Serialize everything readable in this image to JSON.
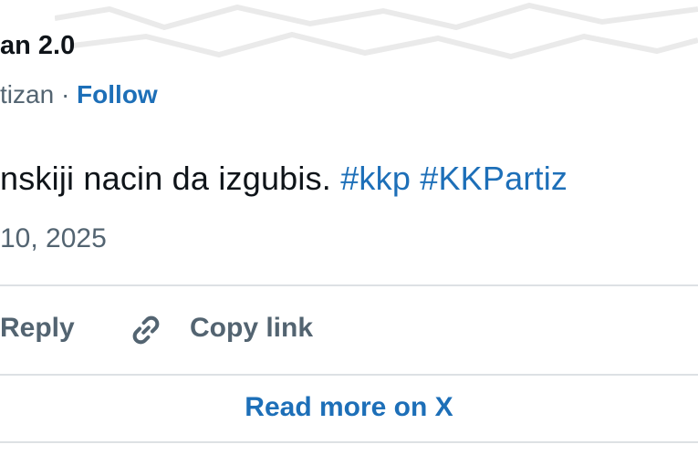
{
  "author": {
    "display_name": "an 2.0",
    "handle": "tizan",
    "separator": "·",
    "follow_label": "Follow"
  },
  "tweet": {
    "text_prefix": "nskiji nacin da izgubis.",
    "hashtags": [
      "#kkp",
      "#KKPartiz"
    ],
    "date": "10, 2025"
  },
  "actions": {
    "reply_label": "Reply",
    "copy_link_label": "Copy link"
  },
  "footer": {
    "read_more_label": "Read more on X"
  },
  "icons": {
    "copy_link": "link-icon"
  },
  "colors": {
    "link_blue": "#1d6fb8",
    "text_dark": "#0f1419",
    "text_gray": "#536471",
    "divider": "#dde1e4"
  }
}
